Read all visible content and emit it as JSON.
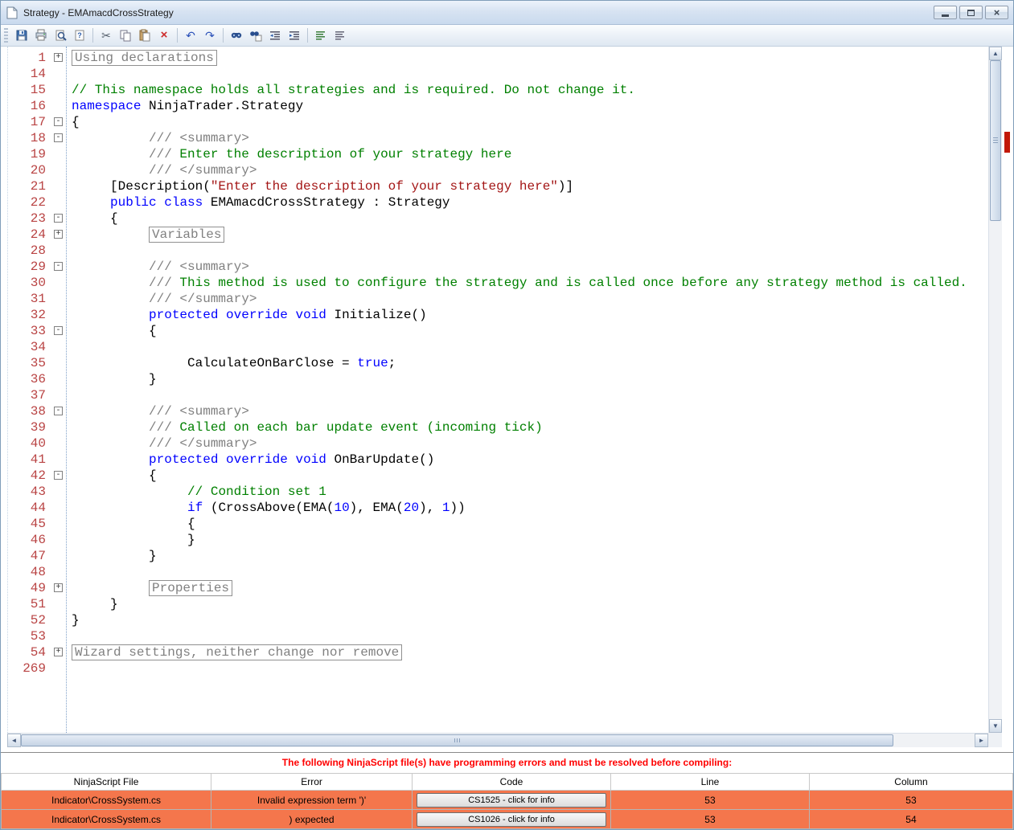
{
  "window": {
    "title": "Strategy - EMAmacdCrossStrategy"
  },
  "toolbar": {
    "groups": [
      [
        "save",
        "print",
        "print-preview",
        "page-setup"
      ],
      [
        "cut",
        "copy",
        "paste",
        "delete"
      ],
      [
        "undo",
        "redo"
      ],
      [
        "find",
        "replace",
        "outdent",
        "indent"
      ],
      [
        "comment",
        "uncomment"
      ]
    ]
  },
  "editor": {
    "colors": {
      "plain": "#000000",
      "kw": "#0000ff",
      "cmt": "#008000",
      "doc": "#808080",
      "str": "#a31515",
      "num": "#0000ff",
      "line_number": "#b94444"
    },
    "lines": [
      {
        "num": "1",
        "fold": "plus",
        "seg": [
          {
            "t": "Using declarations",
            "c": "box"
          }
        ]
      },
      {
        "num": "14",
        "fold": "",
        "seg": []
      },
      {
        "num": "15",
        "fold": "",
        "seg": [
          {
            "t": "// This namespace holds all strategies and is required. Do not change it.",
            "c": "cmt"
          }
        ]
      },
      {
        "num": "16",
        "fold": "",
        "seg": [
          {
            "t": "namespace",
            "c": "kw"
          },
          {
            "t": " NinjaTrader.Strategy",
            "c": "plain"
          }
        ]
      },
      {
        "num": "17",
        "fold": "minus",
        "seg": [
          {
            "t": "{",
            "c": "plain"
          }
        ]
      },
      {
        "num": "18",
        "fold": "minus",
        "seg": [
          {
            "t": "          /// <summary>",
            "c": "doc"
          }
        ]
      },
      {
        "num": "19",
        "fold": "",
        "seg": [
          {
            "t": "          /// ",
            "c": "doc"
          },
          {
            "t": "Enter the description of your strategy here",
            "c": "cmt"
          }
        ]
      },
      {
        "num": "20",
        "fold": "",
        "seg": [
          {
            "t": "          /// </summary>",
            "c": "doc"
          }
        ]
      },
      {
        "num": "21",
        "fold": "",
        "seg": [
          {
            "t": "     [Description(",
            "c": "plain"
          },
          {
            "t": "\"Enter the description of your strategy here\"",
            "c": "str"
          },
          {
            "t": ")]",
            "c": "plain"
          }
        ]
      },
      {
        "num": "22",
        "fold": "",
        "seg": [
          {
            "t": "     ",
            "c": "plain"
          },
          {
            "t": "public",
            "c": "kw"
          },
          {
            "t": " ",
            "c": "plain"
          },
          {
            "t": "class",
            "c": "kw"
          },
          {
            "t": " EMAmacdCrossStrategy : Strategy",
            "c": "plain"
          }
        ]
      },
      {
        "num": "23",
        "fold": "minus",
        "seg": [
          {
            "t": "     {",
            "c": "plain"
          }
        ]
      },
      {
        "num": "24",
        "fold": "plus",
        "seg": [
          {
            "t": "          ",
            "c": "plain"
          },
          {
            "t": "Variables",
            "c": "box"
          }
        ]
      },
      {
        "num": "28",
        "fold": "",
        "seg": []
      },
      {
        "num": "29",
        "fold": "minus",
        "seg": [
          {
            "t": "          /// <summary>",
            "c": "doc"
          }
        ]
      },
      {
        "num": "30",
        "fold": "",
        "seg": [
          {
            "t": "          /// ",
            "c": "doc"
          },
          {
            "t": "This method is used to configure the strategy and is called once before any strategy method is called.",
            "c": "cmt"
          }
        ]
      },
      {
        "num": "31",
        "fold": "",
        "seg": [
          {
            "t": "          /// </summary>",
            "c": "doc"
          }
        ]
      },
      {
        "num": "32",
        "fold": "",
        "seg": [
          {
            "t": "          ",
            "c": "plain"
          },
          {
            "t": "protected",
            "c": "kw"
          },
          {
            "t": " ",
            "c": "plain"
          },
          {
            "t": "override",
            "c": "kw"
          },
          {
            "t": " ",
            "c": "plain"
          },
          {
            "t": "void",
            "c": "kw"
          },
          {
            "t": " Initialize()",
            "c": "plain"
          }
        ]
      },
      {
        "num": "33",
        "fold": "minus",
        "seg": [
          {
            "t": "          {",
            "c": "plain"
          }
        ]
      },
      {
        "num": "34",
        "fold": "",
        "seg": []
      },
      {
        "num": "35",
        "fold": "",
        "seg": [
          {
            "t": "               CalculateOnBarClose = ",
            "c": "plain"
          },
          {
            "t": "true",
            "c": "kw"
          },
          {
            "t": ";",
            "c": "plain"
          }
        ]
      },
      {
        "num": "36",
        "fold": "",
        "seg": [
          {
            "t": "          }",
            "c": "plain"
          }
        ]
      },
      {
        "num": "37",
        "fold": "",
        "seg": []
      },
      {
        "num": "38",
        "fold": "minus",
        "seg": [
          {
            "t": "          /// <summary>",
            "c": "doc"
          }
        ]
      },
      {
        "num": "39",
        "fold": "",
        "seg": [
          {
            "t": "          /// ",
            "c": "doc"
          },
          {
            "t": "Called on each bar update event (incoming tick)",
            "c": "cmt"
          }
        ]
      },
      {
        "num": "40",
        "fold": "",
        "seg": [
          {
            "t": "          /// </summary>",
            "c": "doc"
          }
        ]
      },
      {
        "num": "41",
        "fold": "",
        "seg": [
          {
            "t": "          ",
            "c": "plain"
          },
          {
            "t": "protected",
            "c": "kw"
          },
          {
            "t": " ",
            "c": "plain"
          },
          {
            "t": "override",
            "c": "kw"
          },
          {
            "t": " ",
            "c": "plain"
          },
          {
            "t": "void",
            "c": "kw"
          },
          {
            "t": " OnBarUpdate()",
            "c": "plain"
          }
        ]
      },
      {
        "num": "42",
        "fold": "minus",
        "seg": [
          {
            "t": "          {",
            "c": "plain"
          }
        ]
      },
      {
        "num": "43",
        "fold": "",
        "seg": [
          {
            "t": "               ",
            "c": "plain"
          },
          {
            "t": "// Condition set 1",
            "c": "cmt"
          }
        ]
      },
      {
        "num": "44",
        "fold": "",
        "seg": [
          {
            "t": "               ",
            "c": "plain"
          },
          {
            "t": "if",
            "c": "kw"
          },
          {
            "t": " (CrossAbove(EMA(",
            "c": "plain"
          },
          {
            "t": "10",
            "c": "num"
          },
          {
            "t": "), EMA(",
            "c": "plain"
          },
          {
            "t": "20",
            "c": "num"
          },
          {
            "t": "), ",
            "c": "plain"
          },
          {
            "t": "1",
            "c": "num"
          },
          {
            "t": "))",
            "c": "plain"
          }
        ]
      },
      {
        "num": "45",
        "fold": "",
        "seg": [
          {
            "t": "               {",
            "c": "plain"
          }
        ]
      },
      {
        "num": "46",
        "fold": "",
        "seg": [
          {
            "t": "               }",
            "c": "plain"
          }
        ]
      },
      {
        "num": "47",
        "fold": "",
        "seg": [
          {
            "t": "          }",
            "c": "plain"
          }
        ]
      },
      {
        "num": "48",
        "fold": "",
        "seg": []
      },
      {
        "num": "49",
        "fold": "plus",
        "seg": [
          {
            "t": "          ",
            "c": "plain"
          },
          {
            "t": "Properties",
            "c": "box"
          }
        ]
      },
      {
        "num": "51",
        "fold": "",
        "seg": [
          {
            "t": "     }",
            "c": "plain"
          }
        ]
      },
      {
        "num": "52",
        "fold": "",
        "seg": [
          {
            "t": "}",
            "c": "plain"
          }
        ]
      },
      {
        "num": "53",
        "fold": "",
        "seg": []
      },
      {
        "num": "54",
        "fold": "plus",
        "seg": [
          {
            "t": "Wizard settings, neither change nor remove",
            "c": "box"
          }
        ]
      },
      {
        "num": "269",
        "fold": "",
        "seg": []
      }
    ]
  },
  "error_panel": {
    "message": "The following NinjaScript file(s) have programming errors and must be resolved before compiling:",
    "columns": [
      "NinjaScript File",
      "Error",
      "Code",
      "Line",
      "Column"
    ],
    "rows": [
      {
        "file": "Indicator\\CrossSystem.cs",
        "error": "Invalid expression term ')'",
        "code": "CS1525 - click for info",
        "line": "53",
        "column": "53"
      },
      {
        "file": "Indicator\\CrossSystem.cs",
        "error": ") expected",
        "code": "CS1026 - click for info",
        "line": "53",
        "column": "54"
      }
    ],
    "row_bg": "#f4764c"
  }
}
